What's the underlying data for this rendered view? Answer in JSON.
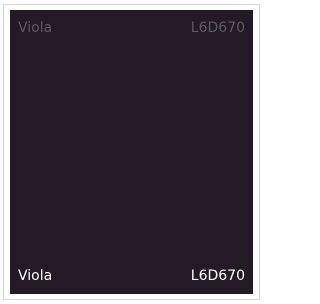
{
  "swatch": {
    "color": "#231a26",
    "top": {
      "name": "Viola",
      "code": "L6D670",
      "color": "#5e5865"
    },
    "bottom": {
      "name": "Viola",
      "code": "L6D670",
      "color": "#ffffff"
    }
  }
}
